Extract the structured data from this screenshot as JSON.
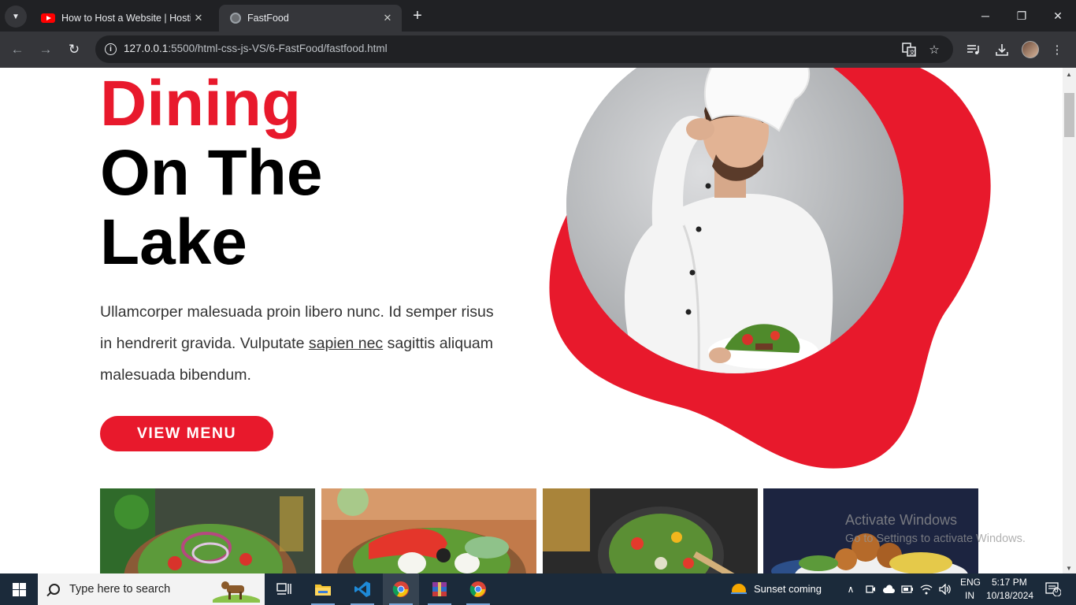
{
  "browser": {
    "tabs": [
      {
        "title": "How to Host a Website | Hosting",
        "favicon": "youtube-icon",
        "active": false
      },
      {
        "title": "FastFood",
        "favicon": "globe-icon",
        "active": true
      }
    ],
    "url_host": "127.0.0.1",
    "url_rest": ":5500/html-css-js-VS/6-FastFood/fastfood.html"
  },
  "page": {
    "hero": {
      "title_accent": "Dining",
      "title_line2": "On The",
      "title_line3": "Lake",
      "text_before_link": "Ullamcorper malesuada proin libero nunc. Id semper risus in hendrerit gravida. Vulputate ",
      "link_text": "sapien nec",
      "text_after_link": " sagittis aliquam malesuada bibendum.",
      "button_label": "VIEW MENU"
    },
    "gallery": [
      {
        "name": "salad-bowl-image"
      },
      {
        "name": "caprese-salad-image"
      },
      {
        "name": "vegetable-pan-image"
      },
      {
        "name": "falafel-plate-image"
      }
    ],
    "accent_color": "#e8192c"
  },
  "watermark": {
    "title": "Activate Windows",
    "subtitle": "Go to Settings to activate Windows."
  },
  "taskbar": {
    "search_placeholder": "Type here to search",
    "weather": "Sunset coming",
    "language_top": "ENG",
    "language_bottom": "IN",
    "time": "5:17 PM",
    "date": "10/18/2024",
    "notification_count": "6"
  }
}
